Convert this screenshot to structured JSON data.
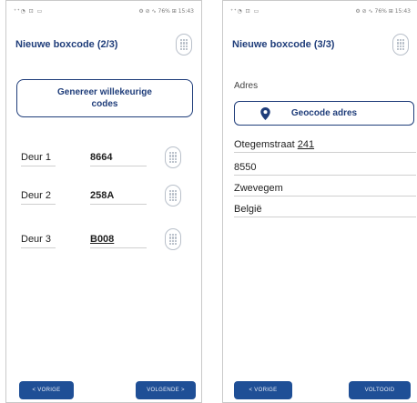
{
  "left_phone": {
    "status_left": "⁺ᐩ◔ ⊡ ▭",
    "status_right": "⚙ ⊘ ∿ 76% ⊞ 15:43",
    "title": "Nieuwe boxcode (2/3)",
    "generate_button": "Genereer willekeurige codes",
    "doors": [
      {
        "label": "Deur 1",
        "code": "8664"
      },
      {
        "label": "Deur 2",
        "code": "258A"
      },
      {
        "label": "Deur 3",
        "code": "B008"
      }
    ],
    "prev_button": "< VORIGE",
    "next_button": "VOLGENDE >"
  },
  "right_phone": {
    "status_left": "⁺ᐩ◔ ⊡ ▭",
    "status_right": "⚙ ⊘ ∿ 76% ⊞ 15:43",
    "title": "Nieuwe boxcode (3/3)",
    "address_label": "Adres",
    "geocode_button": "Geocode adres",
    "address": {
      "street": "Otegemstraat",
      "number": "241",
      "postal": "8550",
      "city": "Zwevegem",
      "country": "België"
    },
    "prev_button": "< VORIGE",
    "finish_button": "VOLTOOID"
  },
  "colors": {
    "primary": "#1f3d7a",
    "button_fill": "#1f4f96",
    "icon_gray": "#b9c0ca"
  }
}
